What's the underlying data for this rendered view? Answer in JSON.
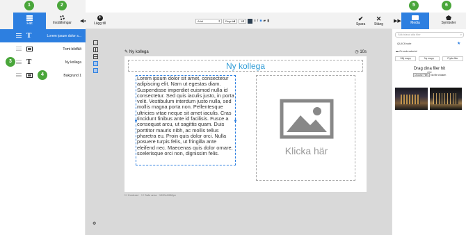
{
  "left_panel": {
    "tabs": [
      {
        "label": "Fält",
        "icon": "list-icon",
        "active": true
      },
      {
        "label": "Inställningar",
        "icon": "gear-icon",
        "active": false
      }
    ],
    "collapse_icon": "double-chevron-left-icon",
    "items": [
      {
        "label": "Lorem ipsum dolor s...",
        "type": "text",
        "selected": true
      },
      {
        "label": "Tomt bildfält",
        "type": "image",
        "selected": false
      },
      {
        "label": "Ny kollega",
        "type": "text",
        "selected": false
      },
      {
        "label": "Bakgrund 1",
        "type": "background",
        "selected": false
      }
    ]
  },
  "badges": [
    "1",
    "2",
    "3",
    "4",
    "5",
    "6"
  ],
  "toolbar": {
    "add_label": "Lägg till",
    "font": "Arial",
    "weight": "Regular",
    "size": "10",
    "color": "#2c3e50",
    "save_label": "Spara",
    "close_label": "Stäng"
  },
  "editor": {
    "slide_title": "Ny kollega",
    "duration": "10s",
    "title_text": "Ny kollega",
    "body_text": "Lorem ipsum dolor sit amet, consectetur adipiscing elit. Nam ut egestas diam. Suspendisse imperdiet euismod nulla id consectetur. Sed quis iaculis justo, in porta velit. Vestibulum interdum justo nulla, sed mollis magna porta non. Pellentesque ultricies vitae neque sit amet iaculis. Cras tincidunt finibus ante id facilisis. Fusce a consequat arcu, ut sagittis quam. Duis porttitor mauris nibh, ac mollis tellus pharetra eu. Proin quis dolor orci. Nulla posuere turpis felis, ut fringilla ante eleifend nec. Maecenas quis dolor ornare, scelerisque orci non, dignissim felis.",
    "image_placeholder": "Klicka här",
    "footer_contrast": "Contrast",
    "footer_safe": "Safe area · 1920x1080px"
  },
  "right_panel": {
    "tabs": [
      {
        "label": "Media",
        "icon": "folder-icon",
        "active": true
      },
      {
        "label": "Symboler",
        "icon": "pentagon-icon",
        "active": false
      }
    ],
    "collapse_icon": "double-chevron-right-icon",
    "search_placeholder": "Sök bland alla filer",
    "folders": [
      "QUICKnote",
      "Grundmaterial"
    ],
    "buttons": [
      "Välj mapp",
      "Ny mapp",
      "Flytta filer"
    ],
    "drop_title": "Drag dina filer hit",
    "drop_or": "eller",
    "choose_files": "Choose Files",
    "no_file": "No file chosen"
  },
  "accent_color": "#2d7fe0",
  "badge_color": "#4aa63b"
}
